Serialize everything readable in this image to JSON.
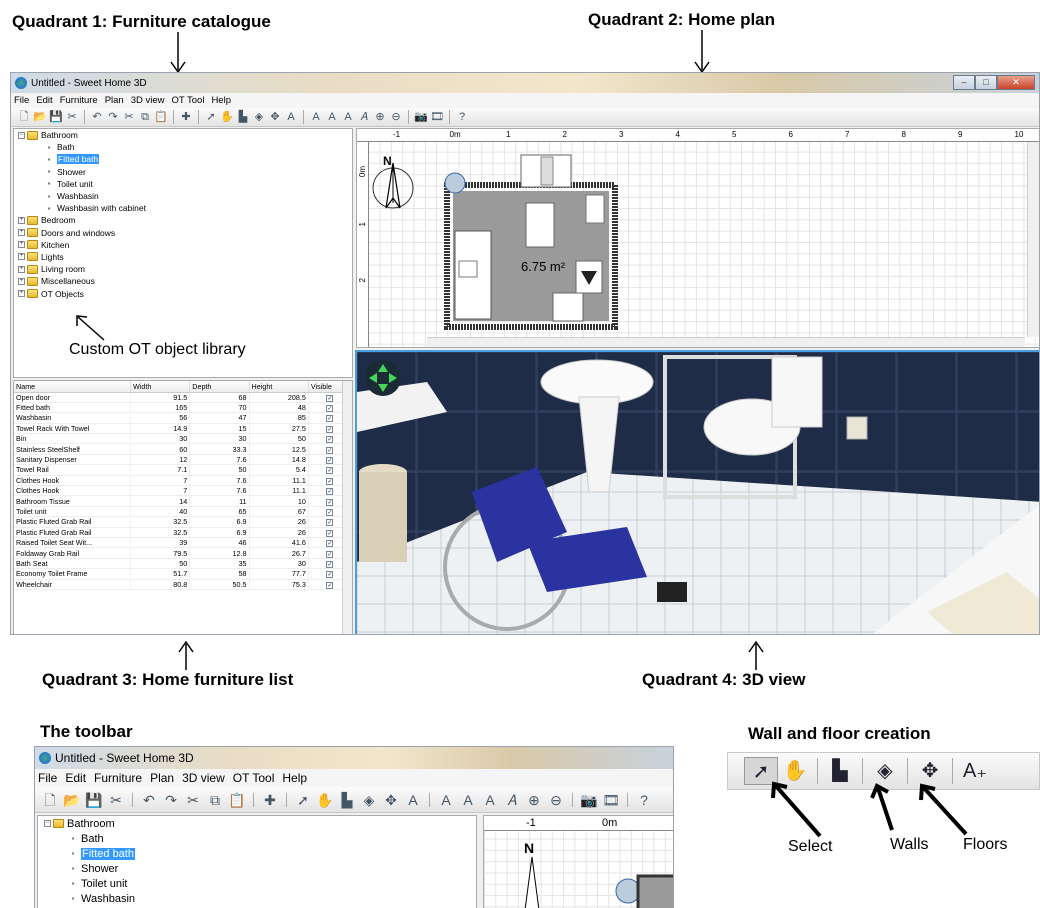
{
  "captions": {
    "q1": "Quadrant 1: Furniture catalogue",
    "q2": "Quadrant 2: Home plan",
    "q3": "Quadrant 3: Home furniture list",
    "q4": "Quadrant 4: 3D view",
    "toolbar": "The toolbar",
    "wall_floor": "Wall and floor creation",
    "custom_lib": "Custom OT object library"
  },
  "window": {
    "title": "Untitled - Sweet Home 3D",
    "menu": [
      "File",
      "Edit",
      "Furniture",
      "Plan",
      "3D view",
      "OT Tool",
      "Help"
    ]
  },
  "toolbar_icons": [
    "new-icon",
    "open-icon",
    "save-icon",
    "cut-tool-icon",
    "|",
    "undo-icon",
    "redo-icon",
    "cut-icon",
    "copy-icon",
    "paste-icon",
    "|",
    "add-furniture-icon",
    "|",
    "select-icon",
    "pan-icon",
    "create-walls-icon",
    "create-floors-icon",
    "create-dimensions-icon",
    "add-text-icon",
    "|",
    "text-style-icon",
    "text-style-icon",
    "text-bold-icon",
    "text-italic-icon",
    "zoom-in-icon",
    "zoom-out-icon",
    "|",
    "photo-icon",
    "video-icon",
    "|",
    "help-icon"
  ],
  "catalogue": {
    "root": "Bathroom",
    "items": [
      "Bath",
      "Fitted bath",
      "Shower",
      "Toilet unit",
      "Washbasin",
      "Washbasin with cabinet"
    ],
    "selected": "Fitted bath",
    "categories": [
      "Bedroom",
      "Doors and windows",
      "Kitchen",
      "Lights",
      "Living room",
      "Miscellaneous",
      "OT Objects"
    ]
  },
  "plan": {
    "ruler_labels": [
      "-1",
      "0m",
      "1",
      "2",
      "3",
      "4",
      "5",
      "6",
      "7",
      "8",
      "9",
      "10"
    ],
    "left_ruler": [
      "0m",
      "1",
      "2"
    ],
    "room_area": "6.75 m²",
    "compass": "N"
  },
  "furniture_list": {
    "columns": [
      "Name",
      "Width",
      "Depth",
      "Height",
      "Visible"
    ],
    "rows": [
      [
        "Open door",
        "91.5",
        "68",
        "208.5"
      ],
      [
        "Fitted bath",
        "165",
        "70",
        "48"
      ],
      [
        "Washbasin",
        "56",
        "47",
        "85"
      ],
      [
        "Towel Rack With Towel",
        "14.9",
        "15",
        "27.5"
      ],
      [
        "Bin",
        "30",
        "30",
        "50"
      ],
      [
        "Stainless SteelShelf",
        "60",
        "33.3",
        "12.5"
      ],
      [
        "Sanitary Dispenser",
        "12",
        "7.6",
        "14.8"
      ],
      [
        "Towel Rail",
        "7.1",
        "50",
        "5.4"
      ],
      [
        "Clothes Hook",
        "7",
        "7.6",
        "11.1"
      ],
      [
        "Clothes Hook",
        "7",
        "7.6",
        "11.1"
      ],
      [
        "Bathroom Tissue",
        "14",
        "11",
        "10"
      ],
      [
        "Toilet unit",
        "40",
        "65",
        "67"
      ],
      [
        "Plastic Fluted Grab Rail",
        "32.5",
        "6.9",
        "26"
      ],
      [
        "Plastic Fluted Grab Rail",
        "32.5",
        "6.9",
        "26"
      ],
      [
        "Raised Toilet Seat Wit...",
        "39",
        "46",
        "41.6"
      ],
      [
        "Foldaway Grab Rail",
        "79.5",
        "12.8",
        "26.7"
      ],
      [
        "Bath Seat",
        "50",
        "35",
        "30"
      ],
      [
        "Economy Toilet Frame",
        "51.7",
        "58",
        "77.7"
      ],
      [
        "Wheelchair",
        "80.8",
        "50.5",
        "75.3"
      ]
    ],
    "visible_mark": "✓"
  },
  "wall_floor_labels": {
    "select": "Select",
    "walls": "Walls",
    "floors": "Floors"
  },
  "colors": {
    "accent": "#3399ff",
    "wall_tile": "#1f2c47",
    "floor_tile": "#e8ecef"
  }
}
